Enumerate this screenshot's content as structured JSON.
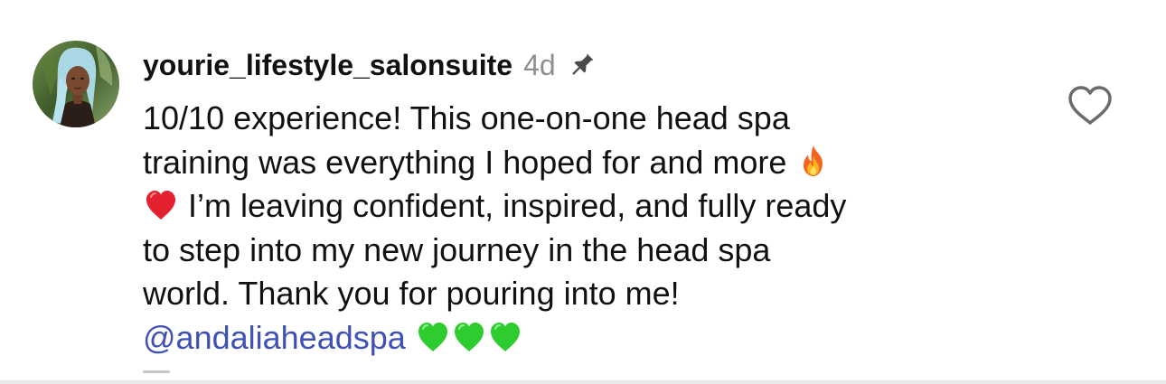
{
  "comment": {
    "username": "yourie_lifestyle_salonsuite",
    "timestamp": "4d",
    "pinned_icon": "pin-icon",
    "like_icon": "heart-outline-icon",
    "lines": [
      {
        "text": "10/10 experience! This one-on-one head spa"
      },
      {
        "text": "training was everything I hoped for and more ",
        "emoji_after": "fire-emoji"
      },
      {
        "emoji_before": "red-heart-emoji",
        "text": " I’m leaving confident, inspired, and fully ready"
      },
      {
        "text": "to step into my new journey in the head spa"
      },
      {
        "text": "world. Thank you for pouring into me!"
      }
    ],
    "mention": "@andaliaheadspa",
    "trailing_emojis": [
      "green-heart-emoji",
      "green-heart-emoji",
      "green-heart-emoji"
    ]
  },
  "colors": {
    "text": "#111111",
    "muted": "#8e8e8e",
    "mention": "#3f51b5",
    "red_heart": "#e5202e",
    "green_heart": "#2ecc2e"
  }
}
